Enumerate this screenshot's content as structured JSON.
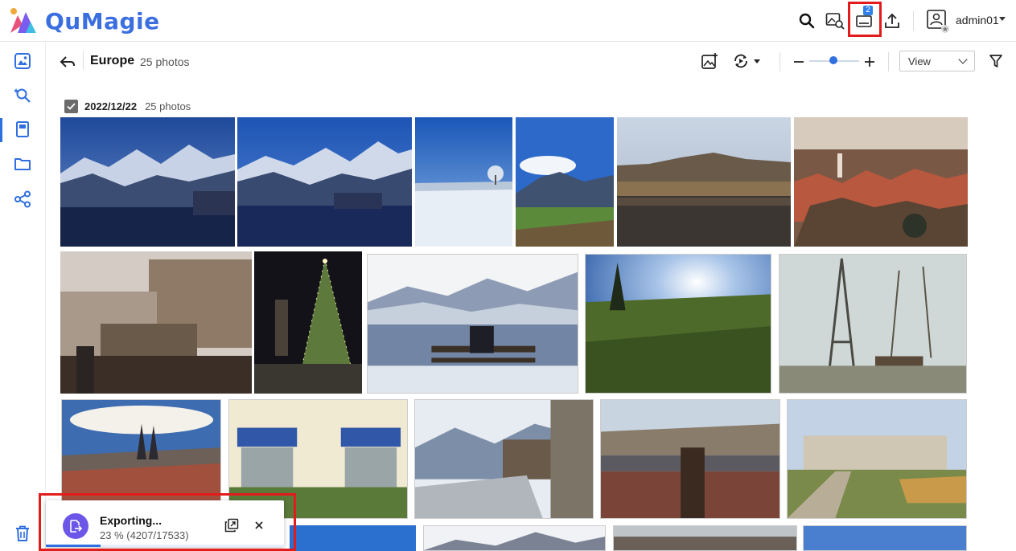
{
  "app": {
    "name": "QuMagie"
  },
  "topbar": {
    "notification_badge": "2",
    "user": "admin01"
  },
  "icons": {
    "search": "search-icon",
    "image_search": "image-search-icon",
    "background_tasks": "background-tasks-icon",
    "upload": "upload-icon",
    "user": "user-icon",
    "photos": "photos-icon",
    "smart": "smart-album-icon",
    "albums": "albums-icon",
    "folders": "folder-icon",
    "share": "share-icon",
    "trash": "trash-icon"
  },
  "album": {
    "title": "Europe",
    "count": "25 photos"
  },
  "toolbar": {
    "view_label": "View"
  },
  "group": {
    "date": "2022/12/22",
    "count": "25 photos"
  },
  "export": {
    "title": "Exporting...",
    "progress_text": "23 % (4207/17533)",
    "progress": 0.23
  },
  "colors": {
    "accent": "#2f6fe0",
    "highlight": "#e21b1b",
    "toast_icon": "#6b56e8"
  }
}
